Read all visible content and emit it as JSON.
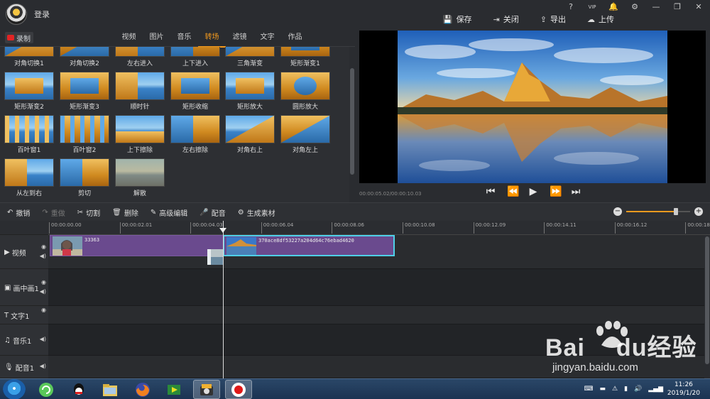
{
  "app": {
    "login_label": "登录",
    "window_controls": [
      "?",
      "VIP",
      "🔔",
      "⚙",
      "—",
      "❐",
      "✕"
    ],
    "actions": [
      {
        "icon": "💾",
        "label": "保存"
      },
      {
        "icon": "⇥",
        "label": "关闭"
      },
      {
        "icon": "⇪",
        "label": "导出"
      },
      {
        "icon": "☁",
        "label": "上传"
      }
    ]
  },
  "media_panel": {
    "record_label": "录制",
    "tabs": [
      "视频",
      "图片",
      "音乐",
      "转场",
      "滤镜",
      "文字",
      "作品"
    ],
    "active_tab": "转场",
    "transitions": [
      "对角切换1",
      "对角切换2",
      "左右进入",
      "上下进入",
      "三角渐变",
      "矩形渐变1",
      "矩形渐变2",
      "矩形渐变3",
      "顺时针",
      "矩形收缩",
      "矩形放大",
      "圆形放大",
      "百叶窗1",
      "百叶窗2",
      "上下擦除",
      "左右擦除",
      "对角右上",
      "对角左上",
      "从左到右",
      "剪切",
      "解散"
    ]
  },
  "preview": {
    "timecode": "00:00:05.02/00:00:10.03",
    "controls": [
      "⏮",
      "⏪",
      "▶",
      "⏩",
      "⏭"
    ]
  },
  "toolbar": {
    "tools": [
      {
        "icon": "↶",
        "label": "撤销",
        "enabled": true
      },
      {
        "icon": "↷",
        "label": "重做",
        "enabled": false
      },
      {
        "icon": "✂",
        "label": "切割",
        "enabled": true
      },
      {
        "icon": "🗑",
        "label": "删除",
        "enabled": true
      },
      {
        "icon": "✎",
        "label": "高级编辑",
        "enabled": true
      },
      {
        "icon": "🎤",
        "label": "配音",
        "enabled": true
      },
      {
        "icon": "⚙",
        "label": "生成素材",
        "enabled": true
      }
    ],
    "zoom_level": 0.78
  },
  "timeline": {
    "ruler": [
      "00:00:00.00",
      "00:00:02.01",
      "00:00:04.03",
      "00:00:06.04",
      "00:00:08.06",
      "00:00:10.08",
      "00:00:12.09",
      "00:00:14.11",
      "00:00:16.12",
      "00:00:18."
    ],
    "tracks": [
      {
        "icon": "▶",
        "label": "视频",
        "eye": true,
        "speaker": true
      },
      {
        "icon": "▣",
        "label": "画中画1",
        "eye": true,
        "speaker": true
      },
      {
        "icon": "T",
        "label": "文字1",
        "eye": true,
        "speaker": false
      },
      {
        "icon": "♫",
        "label": "音乐1",
        "eye": false,
        "speaker": true
      },
      {
        "icon": "🎙",
        "label": "配音1",
        "eye": false,
        "speaker": true
      }
    ],
    "clips": [
      {
        "name": "33363"
      },
      {
        "name": "370ace8df53227a204d64c76ebad4620"
      }
    ]
  },
  "watermark": {
    "brand": "Bai",
    "brand_du": "du",
    "suffix": "经验",
    "url": "jingyan.baidu.com"
  },
  "taskbar": {
    "time": "11:26",
    "date": "2019/1/20"
  },
  "colors": {
    "accent": "#f39a1e",
    "clip": "#6a4a8e",
    "selected_clip_border": "#4fd0e8"
  }
}
